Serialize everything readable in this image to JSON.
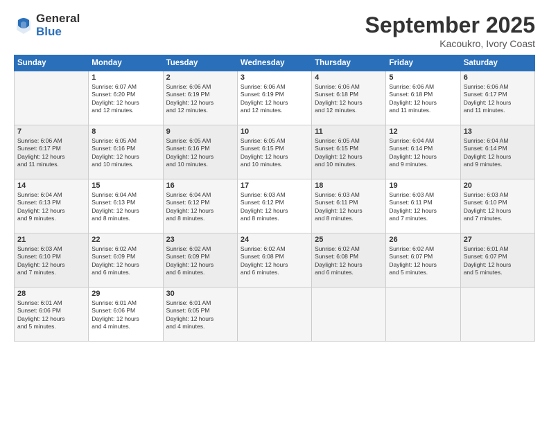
{
  "logo": {
    "general": "General",
    "blue": "Blue"
  },
  "title": "September 2025",
  "subtitle": "Kacoukro, Ivory Coast",
  "days_header": [
    "Sunday",
    "Monday",
    "Tuesday",
    "Wednesday",
    "Thursday",
    "Friday",
    "Saturday"
  ],
  "weeks": [
    [
      {
        "num": "",
        "info": ""
      },
      {
        "num": "1",
        "info": "Sunrise: 6:07 AM\nSunset: 6:20 PM\nDaylight: 12 hours\nand 12 minutes."
      },
      {
        "num": "2",
        "info": "Sunrise: 6:06 AM\nSunset: 6:19 PM\nDaylight: 12 hours\nand 12 minutes."
      },
      {
        "num": "3",
        "info": "Sunrise: 6:06 AM\nSunset: 6:19 PM\nDaylight: 12 hours\nand 12 minutes."
      },
      {
        "num": "4",
        "info": "Sunrise: 6:06 AM\nSunset: 6:18 PM\nDaylight: 12 hours\nand 12 minutes."
      },
      {
        "num": "5",
        "info": "Sunrise: 6:06 AM\nSunset: 6:18 PM\nDaylight: 12 hours\nand 11 minutes."
      },
      {
        "num": "6",
        "info": "Sunrise: 6:06 AM\nSunset: 6:17 PM\nDaylight: 12 hours\nand 11 minutes."
      }
    ],
    [
      {
        "num": "7",
        "info": "Sunrise: 6:06 AM\nSunset: 6:17 PM\nDaylight: 12 hours\nand 11 minutes."
      },
      {
        "num": "8",
        "info": "Sunrise: 6:05 AM\nSunset: 6:16 PM\nDaylight: 12 hours\nand 10 minutes."
      },
      {
        "num": "9",
        "info": "Sunrise: 6:05 AM\nSunset: 6:16 PM\nDaylight: 12 hours\nand 10 minutes."
      },
      {
        "num": "10",
        "info": "Sunrise: 6:05 AM\nSunset: 6:15 PM\nDaylight: 12 hours\nand 10 minutes."
      },
      {
        "num": "11",
        "info": "Sunrise: 6:05 AM\nSunset: 6:15 PM\nDaylight: 12 hours\nand 10 minutes."
      },
      {
        "num": "12",
        "info": "Sunrise: 6:04 AM\nSunset: 6:14 PM\nDaylight: 12 hours\nand 9 minutes."
      },
      {
        "num": "13",
        "info": "Sunrise: 6:04 AM\nSunset: 6:14 PM\nDaylight: 12 hours\nand 9 minutes."
      }
    ],
    [
      {
        "num": "14",
        "info": "Sunrise: 6:04 AM\nSunset: 6:13 PM\nDaylight: 12 hours\nand 9 minutes."
      },
      {
        "num": "15",
        "info": "Sunrise: 6:04 AM\nSunset: 6:13 PM\nDaylight: 12 hours\nand 8 minutes."
      },
      {
        "num": "16",
        "info": "Sunrise: 6:04 AM\nSunset: 6:12 PM\nDaylight: 12 hours\nand 8 minutes."
      },
      {
        "num": "17",
        "info": "Sunrise: 6:03 AM\nSunset: 6:12 PM\nDaylight: 12 hours\nand 8 minutes."
      },
      {
        "num": "18",
        "info": "Sunrise: 6:03 AM\nSunset: 6:11 PM\nDaylight: 12 hours\nand 8 minutes."
      },
      {
        "num": "19",
        "info": "Sunrise: 6:03 AM\nSunset: 6:11 PM\nDaylight: 12 hours\nand 7 minutes."
      },
      {
        "num": "20",
        "info": "Sunrise: 6:03 AM\nSunset: 6:10 PM\nDaylight: 12 hours\nand 7 minutes."
      }
    ],
    [
      {
        "num": "21",
        "info": "Sunrise: 6:03 AM\nSunset: 6:10 PM\nDaylight: 12 hours\nand 7 minutes."
      },
      {
        "num": "22",
        "info": "Sunrise: 6:02 AM\nSunset: 6:09 PM\nDaylight: 12 hours\nand 6 minutes."
      },
      {
        "num": "23",
        "info": "Sunrise: 6:02 AM\nSunset: 6:09 PM\nDaylight: 12 hours\nand 6 minutes."
      },
      {
        "num": "24",
        "info": "Sunrise: 6:02 AM\nSunset: 6:08 PM\nDaylight: 12 hours\nand 6 minutes."
      },
      {
        "num": "25",
        "info": "Sunrise: 6:02 AM\nSunset: 6:08 PM\nDaylight: 12 hours\nand 6 minutes."
      },
      {
        "num": "26",
        "info": "Sunrise: 6:02 AM\nSunset: 6:07 PM\nDaylight: 12 hours\nand 5 minutes."
      },
      {
        "num": "27",
        "info": "Sunrise: 6:01 AM\nSunset: 6:07 PM\nDaylight: 12 hours\nand 5 minutes."
      }
    ],
    [
      {
        "num": "28",
        "info": "Sunrise: 6:01 AM\nSunset: 6:06 PM\nDaylight: 12 hours\nand 5 minutes."
      },
      {
        "num": "29",
        "info": "Sunrise: 6:01 AM\nSunset: 6:06 PM\nDaylight: 12 hours\nand 4 minutes."
      },
      {
        "num": "30",
        "info": "Sunrise: 6:01 AM\nSunset: 6:05 PM\nDaylight: 12 hours\nand 4 minutes."
      },
      {
        "num": "",
        "info": ""
      },
      {
        "num": "",
        "info": ""
      },
      {
        "num": "",
        "info": ""
      },
      {
        "num": "",
        "info": ""
      }
    ]
  ]
}
